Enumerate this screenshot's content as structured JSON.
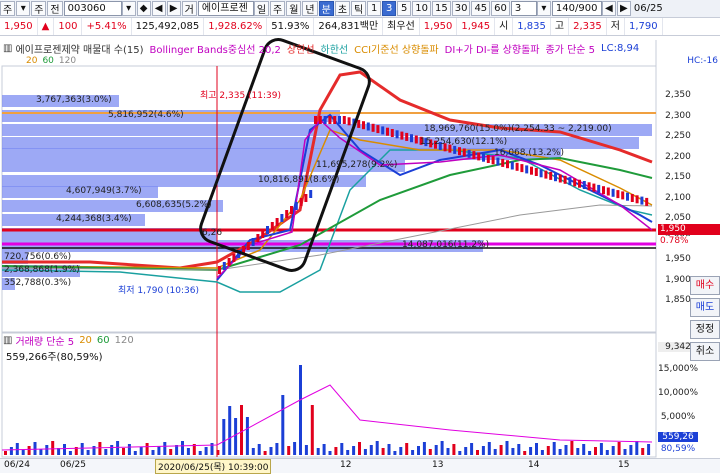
{
  "toolbar": {
    "b1": "주",
    "b2": "▾",
    "b3": "주",
    "b4": "전",
    "code": "003060",
    "icons": [
      "▾",
      "◆",
      "◀",
      "▶"
    ],
    "s1": "거",
    "name": "에이프로젠",
    "periods": [
      "일",
      "주",
      "월",
      "년",
      "분",
      "초",
      "틱"
    ],
    "p1": "1",
    "p2": "3",
    "p3": "5",
    "p4": "10",
    "p5": "15",
    "p6": "30",
    "p7": "45",
    "p8": "60",
    "select_value": "3",
    "counter": "140/900",
    "end_icons": [
      "◀",
      "▶"
    ],
    "date_fragment": "06/25"
  },
  "quote": {
    "price": "1,950",
    "arrow": "▲",
    "change": "100",
    "pct": "+5.41%",
    "volume": "125,492,085",
    "vol_ratio": "1,928.62%",
    "v3": "51.93%",
    "turnover": "264,831백만",
    "label_best": "최우선",
    "ask": "1,950",
    "bid": "1,945",
    "open_label": "시",
    "open": "1,835",
    "high_label": "고",
    "high": "2,335",
    "low_label": "저",
    "low": "1,790"
  },
  "legend": {
    "name": "에이프로젠제약 매물대 수(15)",
    "bb": "Bollinger Bands중심선 20,2",
    "upper": "상한선",
    "lower": "하한선",
    "cci": "CCI기준선 상향돌파",
    "di": "DI+가 DI-를 상향돌파",
    "ma": "종가 단순 5",
    "ma_periods": [
      "20",
      "60",
      "120"
    ],
    "lc": "LC:8,94",
    "hc": "HC:-16"
  },
  "volume_panel": {
    "title": "거래량 단순 5",
    "periods": [
      "20",
      "60",
      "120"
    ],
    "total": "559,266주(80,59%)"
  },
  "price_axis": [
    "2,350",
    "2,300",
    "2,250",
    "2,200",
    "2,150",
    "2,100",
    "2,050",
    "2,000",
    "1,950",
    "1,900",
    "1,850"
  ],
  "price_tags": {
    "current": "1,950",
    "pct": "0.78%"
  },
  "vol_axis": {
    "top": "9,342",
    "v1": "15,000%",
    "v2": "10,000%",
    "v3": "5,000%",
    "cur": "559,26",
    "pct": "80,59%"
  },
  "side_buttons": [
    "매수",
    "매도",
    "정정",
    "취소"
  ],
  "annotations": {
    "high": "최고 2,335 (11:39)",
    "low": "최저 1,790 (10:36)",
    "vp": [
      "3,767,363(3.0%)",
      "5,816,952(4.6%)",
      "18,969,760(15.0%)(2,254.33 ~ 2,219.00)",
      "15,254,630(12.1%)",
      "16,068,(13.2%)",
      "11,695,278(9.2%)",
      "10,816,891(8.6%)",
      "4,607,949(3.7%)",
      "6,608,635(5.2%)",
      "4,244,368(3.4%)",
      "6,26",
      "14,087,016(11.2%)",
      "720,756(0.6%)",
      "2,368,868(1.9%)",
      "352,788(0.3%)"
    ]
  },
  "date_axis": {
    "d1": "06/24",
    "d2": "06/25",
    "cursor": "2020/06/25(목) 10:39:00",
    "t12": "12",
    "t13": "13",
    "t14": "14",
    "t15": "15"
  },
  "colors": {
    "up": "#e1001c",
    "down": "#1b3fd6",
    "vp": "#7c8cf2",
    "bb": "#e52b2b",
    "accent": "#3a6bd1"
  }
}
